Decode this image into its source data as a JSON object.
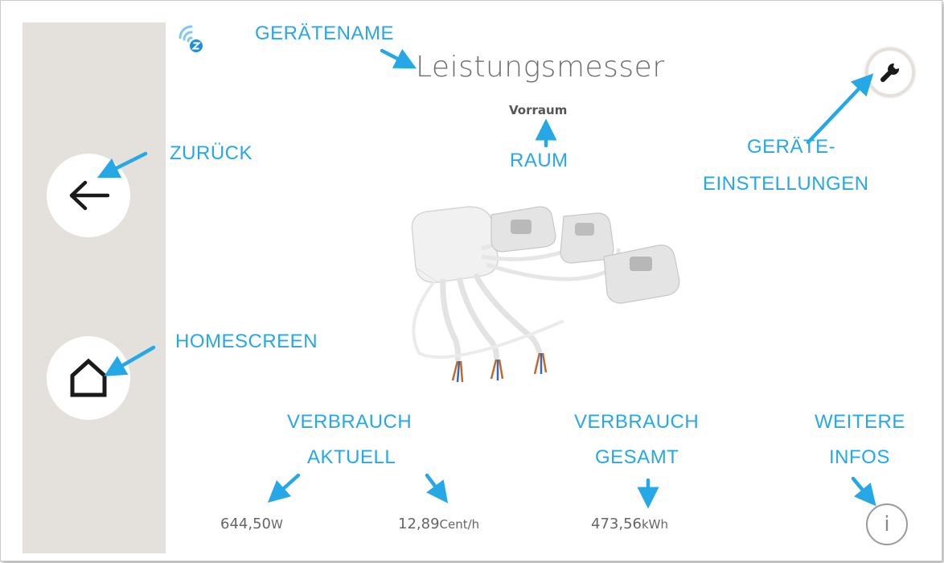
{
  "header": {
    "device_name": "Leistungsmesser",
    "room": "Vorraum"
  },
  "readings": {
    "current_power": {
      "value": "644,50",
      "unit": "W"
    },
    "current_cost": {
      "value": "12,89",
      "unit": "Cent/h"
    },
    "total_energy": {
      "value": "473,56",
      "unit": "kWh"
    }
  },
  "annotations": {
    "device_name": "GERÄTENAME",
    "room": "RAUM",
    "back": "ZURÜCK",
    "home": "HOMESCREEN",
    "settings_line1": "GERÄTE-",
    "settings_line2": "EINSTELLUNGEN",
    "consumption_current_line1": "VERBRAUCH",
    "consumption_current_line2": "AKTUELL",
    "consumption_total_line1": "VERBRAUCH",
    "consumption_total_line2": "GESAMT",
    "more_info_line1": "WEITERE",
    "more_info_line2": "INFOS"
  },
  "icons": {
    "back": "arrow-left-icon",
    "home": "home-icon",
    "settings": "wrench-icon",
    "info": "info-icon",
    "zwave": "zwave-icon"
  },
  "info_symbol": "i",
  "colors": {
    "annotation": "#27a8e6",
    "sidebar": "#e4e0dc",
    "text": "#6f6f6f"
  }
}
